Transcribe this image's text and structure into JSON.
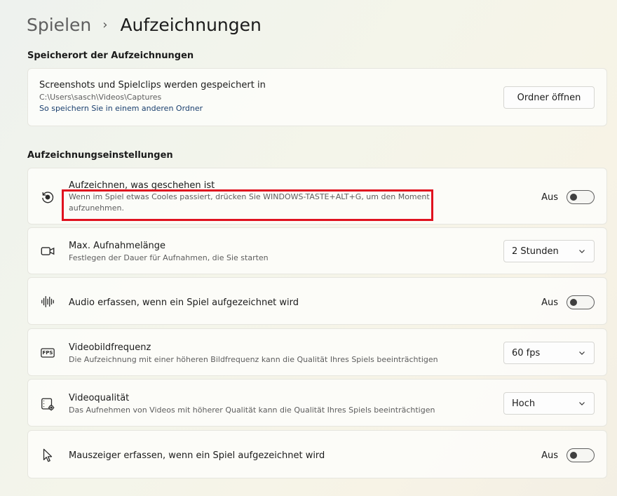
{
  "breadcrumb": {
    "parent": "Spielen",
    "separator": "›",
    "current": "Aufzeichnungen"
  },
  "storage": {
    "section_title": "Speicherort der Aufzeichnungen",
    "title": "Screenshots und Spielclips werden gespeichert in",
    "path": "C:\\Users\\sasch\\Videos\\Captures",
    "link": "So speichern Sie in einem anderen Ordner",
    "button": "Ordner öffnen"
  },
  "settings": {
    "section_title": "Aufzeichnungseinstellungen",
    "record_what_happened": {
      "title": "Aufzeichnen, was geschehen ist",
      "desc_line1": "Wenn im Spiel etwas Cooles passiert, drücken Sie WINDOWS-TASTE+ALT+G, um den Moment",
      "desc_line2": "aufzunehmen.",
      "state": "Aus",
      "icon": "replay-record-icon"
    },
    "max_length": {
      "title": "Max. Aufnahmelänge",
      "desc": "Festlegen der Dauer für Aufnahmen, die Sie starten",
      "value": "2 Stunden",
      "icon": "video-camera-icon"
    },
    "audio": {
      "title": "Audio erfassen, wenn ein Spiel aufgezeichnet wird",
      "state": "Aus",
      "icon": "audio-waveform-icon"
    },
    "framerate": {
      "title": "Videobildfrequenz",
      "desc": "Die Aufzeichnung mit einer höheren Bildfrequenz kann die Qualität Ihres Spiels beeinträchtigen",
      "value": "60 fps",
      "icon_text": "FPS",
      "icon": "fps-icon"
    },
    "quality": {
      "title": "Videoqualität",
      "desc": "Das Aufnehmen von Videos mit höherer Qualität kann die Qualität Ihres Spiels beeinträchtigen",
      "value": "Hoch",
      "icon": "video-settings-icon"
    },
    "cursor": {
      "title": "Mauszeiger erfassen, wenn ein Spiel aufgezeichnet wird",
      "state": "Aus",
      "icon": "mouse-pointer-icon"
    }
  },
  "colors": {
    "highlight": "#e0121f",
    "link": "#1a3f6e"
  }
}
